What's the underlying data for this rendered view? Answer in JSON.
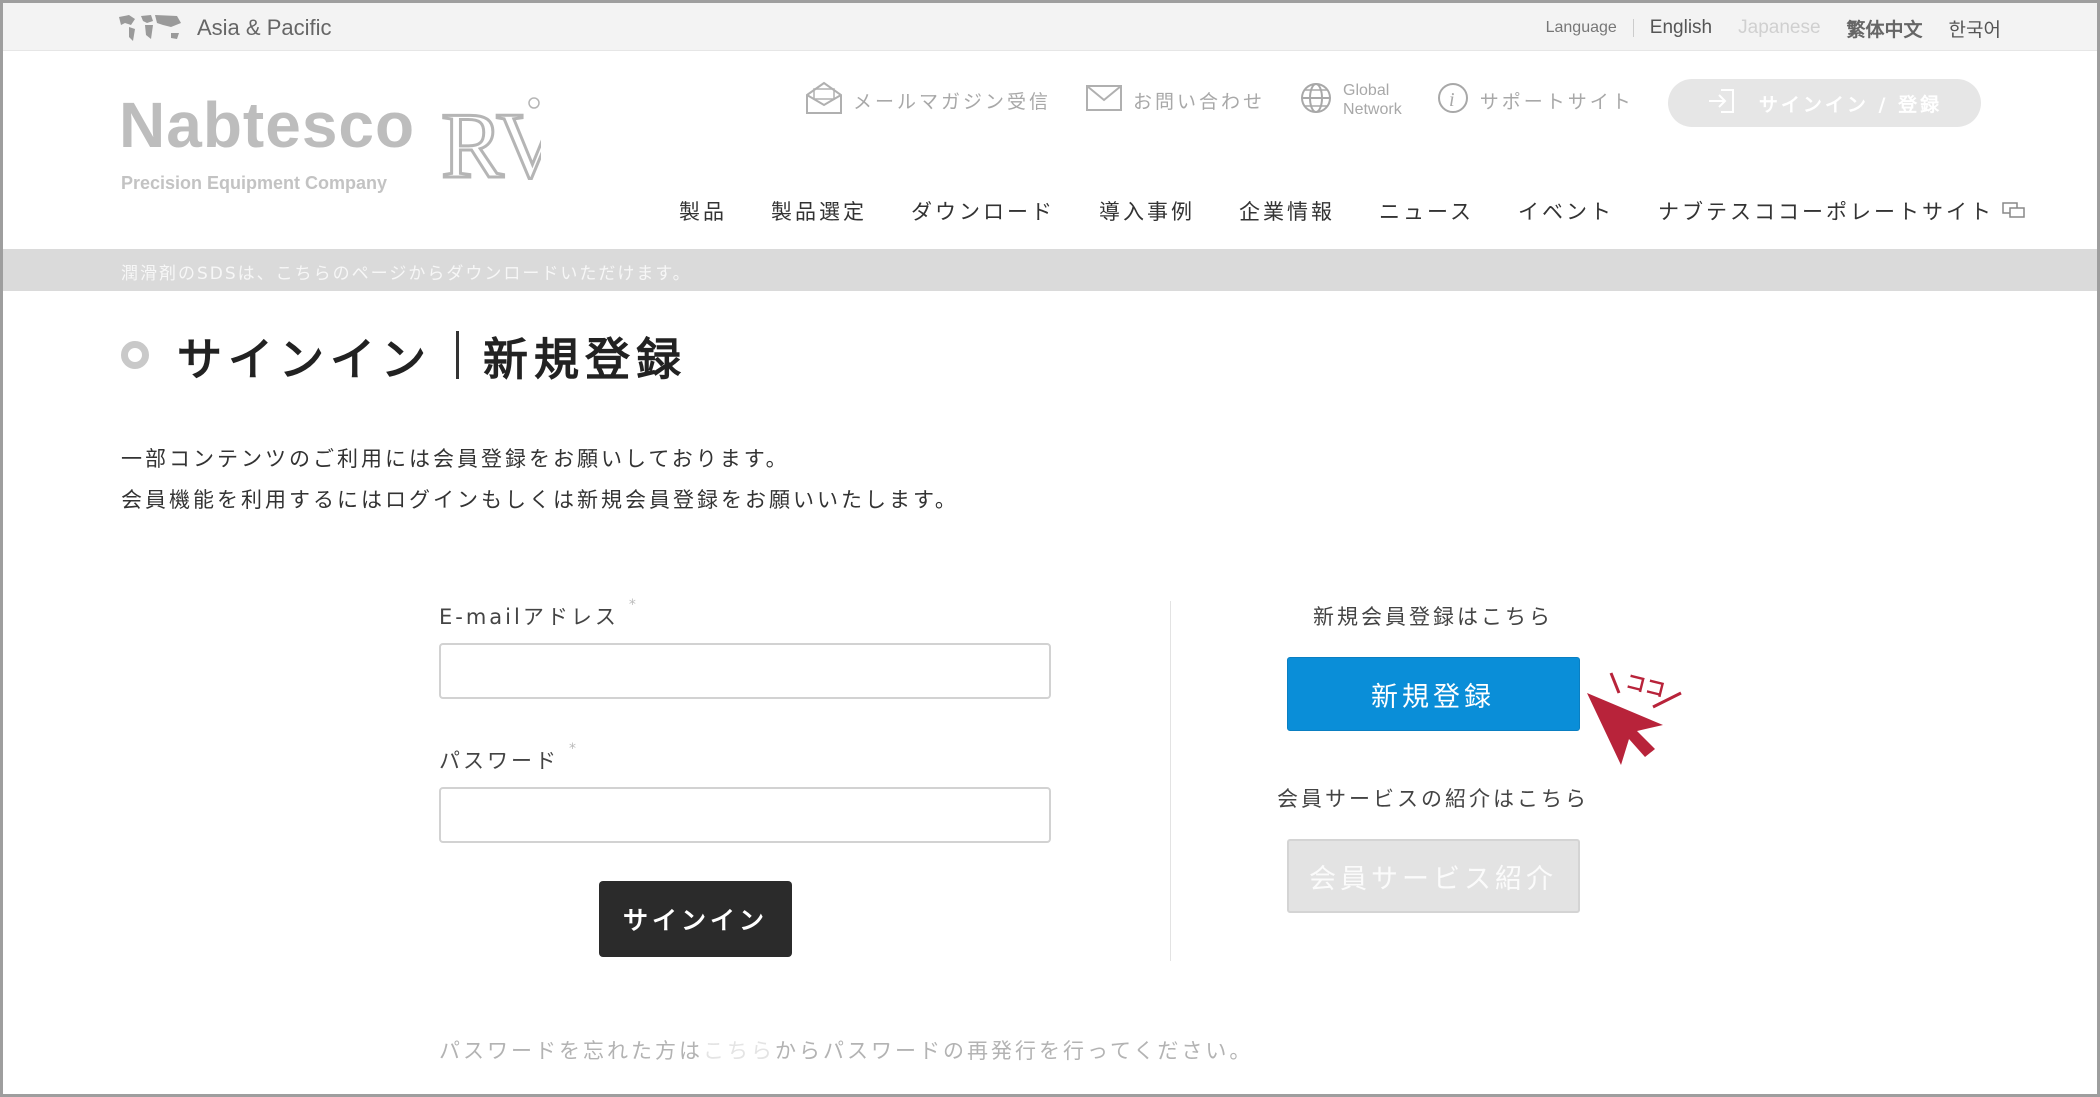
{
  "topbar": {
    "region_label": "Asia & Pacific",
    "language_title": "Language",
    "languages": [
      "English",
      "Japanese",
      "繁体中文",
      "한국어"
    ]
  },
  "header": {
    "brand": "Nabtesco",
    "tagline": "Precision Equipment Company",
    "product_mark": "RV",
    "utility_links": {
      "newsletter": "メールマガジン受信",
      "contact": "お問い合わせ",
      "global_network": [
        "Global",
        "Network"
      ],
      "support": "サポートサイト"
    },
    "signin_register": "サインイン / 登録",
    "nav": [
      "製品",
      "製品選定",
      "ダウンロード",
      "導入事例",
      "企業情報",
      "ニュース",
      "イベント",
      "ナブテスココーポレートサイト"
    ]
  },
  "notice": "潤滑剤のSDSは、こちらのページからダウンロードいただけます。",
  "page": {
    "title_signin": "サインイン",
    "title_register": "新規登録",
    "intro": [
      "一部コンテンツのご利用には会員登録をお願いしております。",
      "会員機能を利用するにはログインもしくは新規会員登録をお願いいたします。"
    ]
  },
  "form": {
    "email_label": "E-mailアドレス",
    "password_label": "パスワード",
    "required_mark": "*",
    "email_value": "",
    "password_value": "",
    "signin_button": "サインイン"
  },
  "register": {
    "caption": "新規会員登録はこちら",
    "button": "新規登録",
    "service_caption": "会員サービスの紹介はこちら",
    "service_button": "会員サービス紹介",
    "pointer_text": "ココ"
  },
  "forgot": {
    "before": "パスワードを忘れた方は",
    "link": "こちら",
    "after": "からパスワードの再発行を行ってください。"
  },
  "colors": {
    "primary_blue": "#0a8ed8",
    "dark_button": "#2b2b2b",
    "pointer_red": "#b8233a"
  }
}
